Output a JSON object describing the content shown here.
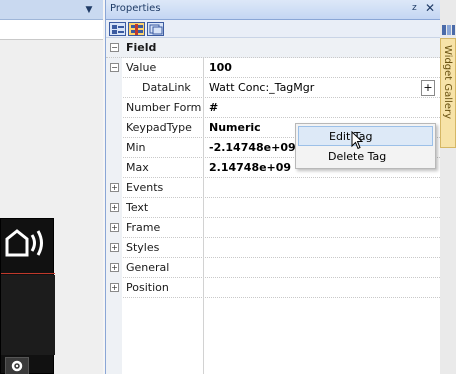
{
  "panel": {
    "title": "Properties",
    "pin_glyph": "p",
    "close_glyph": "✕"
  },
  "toolbar": {
    "buttons": [
      "categorized-view-icon",
      "alphabetical-view-icon",
      "property-pages-icon"
    ]
  },
  "grid": {
    "section": "Field",
    "rows": [
      {
        "label": "Value",
        "value": "100",
        "expander": "−"
      },
      {
        "label": "DataLink",
        "value": "Watt Conc:_TagMgr"
      },
      {
        "label": "Number Forma",
        "value": "#"
      },
      {
        "label": "KeypadType",
        "value": "Numeric"
      },
      {
        "label": "Min",
        "value": "-2.14748e+09"
      },
      {
        "label": "Max",
        "value": "2.14748e+09"
      },
      {
        "label": "Events",
        "expander": "+"
      },
      {
        "label": "Text",
        "expander": "+"
      },
      {
        "label": "Frame",
        "expander": "+"
      },
      {
        "label": "Styles",
        "expander": "+"
      },
      {
        "label": "General",
        "expander": "+"
      },
      {
        "label": "Position",
        "expander": "+"
      }
    ],
    "plus_label": "+"
  },
  "context_menu": {
    "items": [
      "Edit Tag",
      "Delete Tag"
    ]
  },
  "widget_gallery": {
    "label": "Widget Gallery"
  },
  "colors": {
    "panel_border": "#8aa6d6",
    "title_bar": "#c4d6f3",
    "menu_highlight": "#dde9f7",
    "gallery_tab": "#f7e3a8"
  }
}
